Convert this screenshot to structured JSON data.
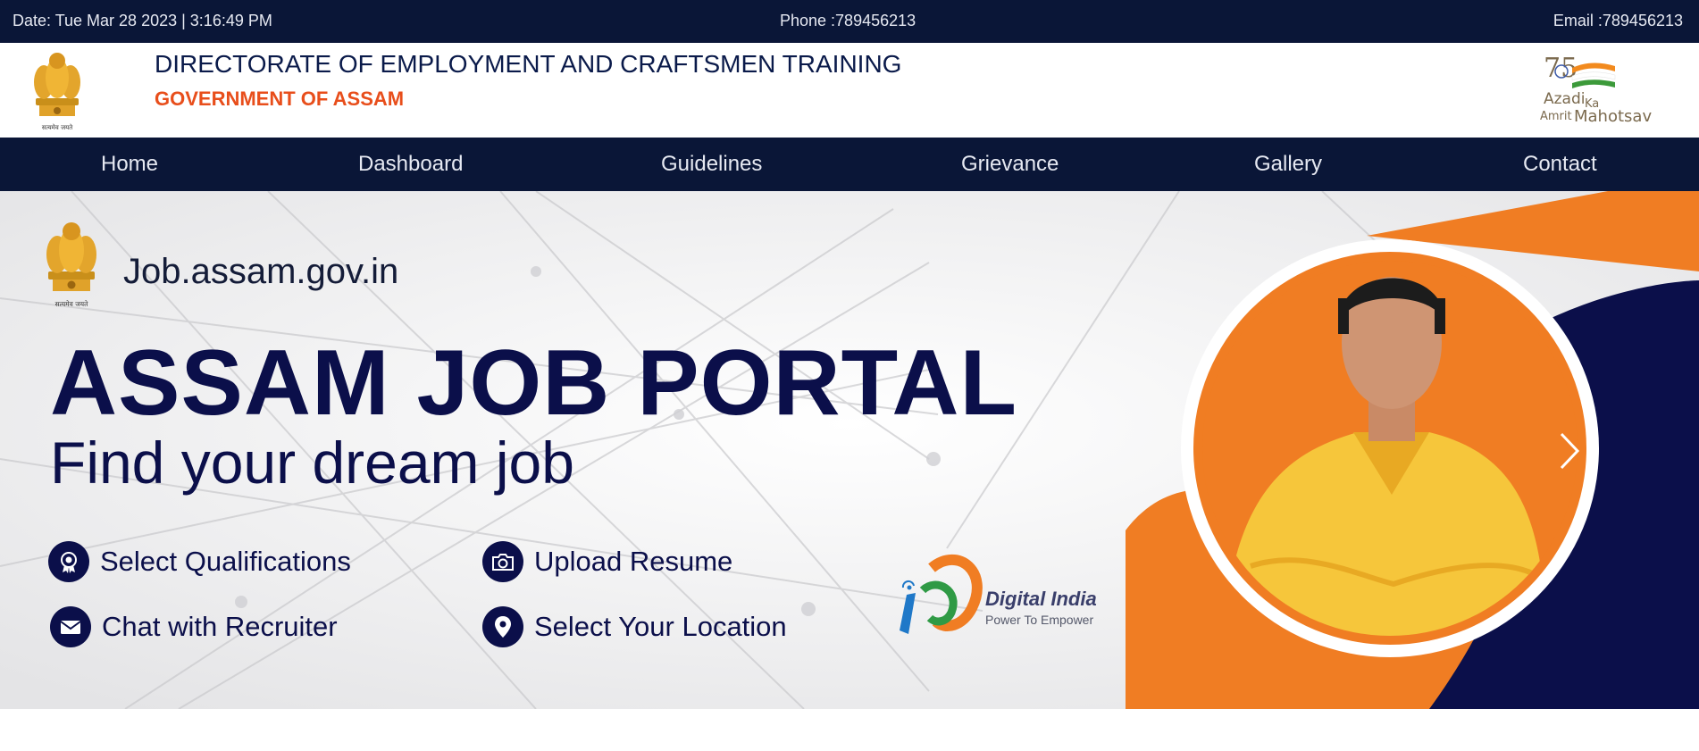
{
  "topbar": {
    "date": "Date: Tue Mar 28 2023 | 3:16:49 PM",
    "phone": "Phone :789456213",
    "email": "Email :789456213"
  },
  "header": {
    "emblem_caption": "सत्यमेव जयते",
    "title": "DIRECTORATE OF EMPLOYMENT AND CRAFTSMEN TRAINING",
    "subtitle": "GOVERNMENT OF ASSAM",
    "azadi": {
      "number": "75",
      "word1": "Azadi",
      "word2": "Ka",
      "word3": "Amrit",
      "word4": "Mahotsav"
    }
  },
  "nav": [
    "Home",
    "Dashboard",
    "Guidelines",
    "Grievance",
    "Gallery",
    "Contact"
  ],
  "banner": {
    "emblem_caption": "सत्यमेव जयते",
    "site": "Job.assam.gov.in",
    "hero": "ASSAM JOB PORTAL",
    "tagline": "Find your dream job",
    "features": {
      "qualifications": "Select Qualifications",
      "resume": "Upload Resume",
      "chat": "Chat with Recruiter",
      "location": "Select Your Location"
    },
    "digital_india": {
      "title": "Digital India",
      "sub": "Power To Empower"
    }
  },
  "colors": {
    "navy": "#0a1637",
    "hero_navy": "#0b0f4a",
    "orange": "#f07d23",
    "red_accent": "#e84e1b"
  }
}
